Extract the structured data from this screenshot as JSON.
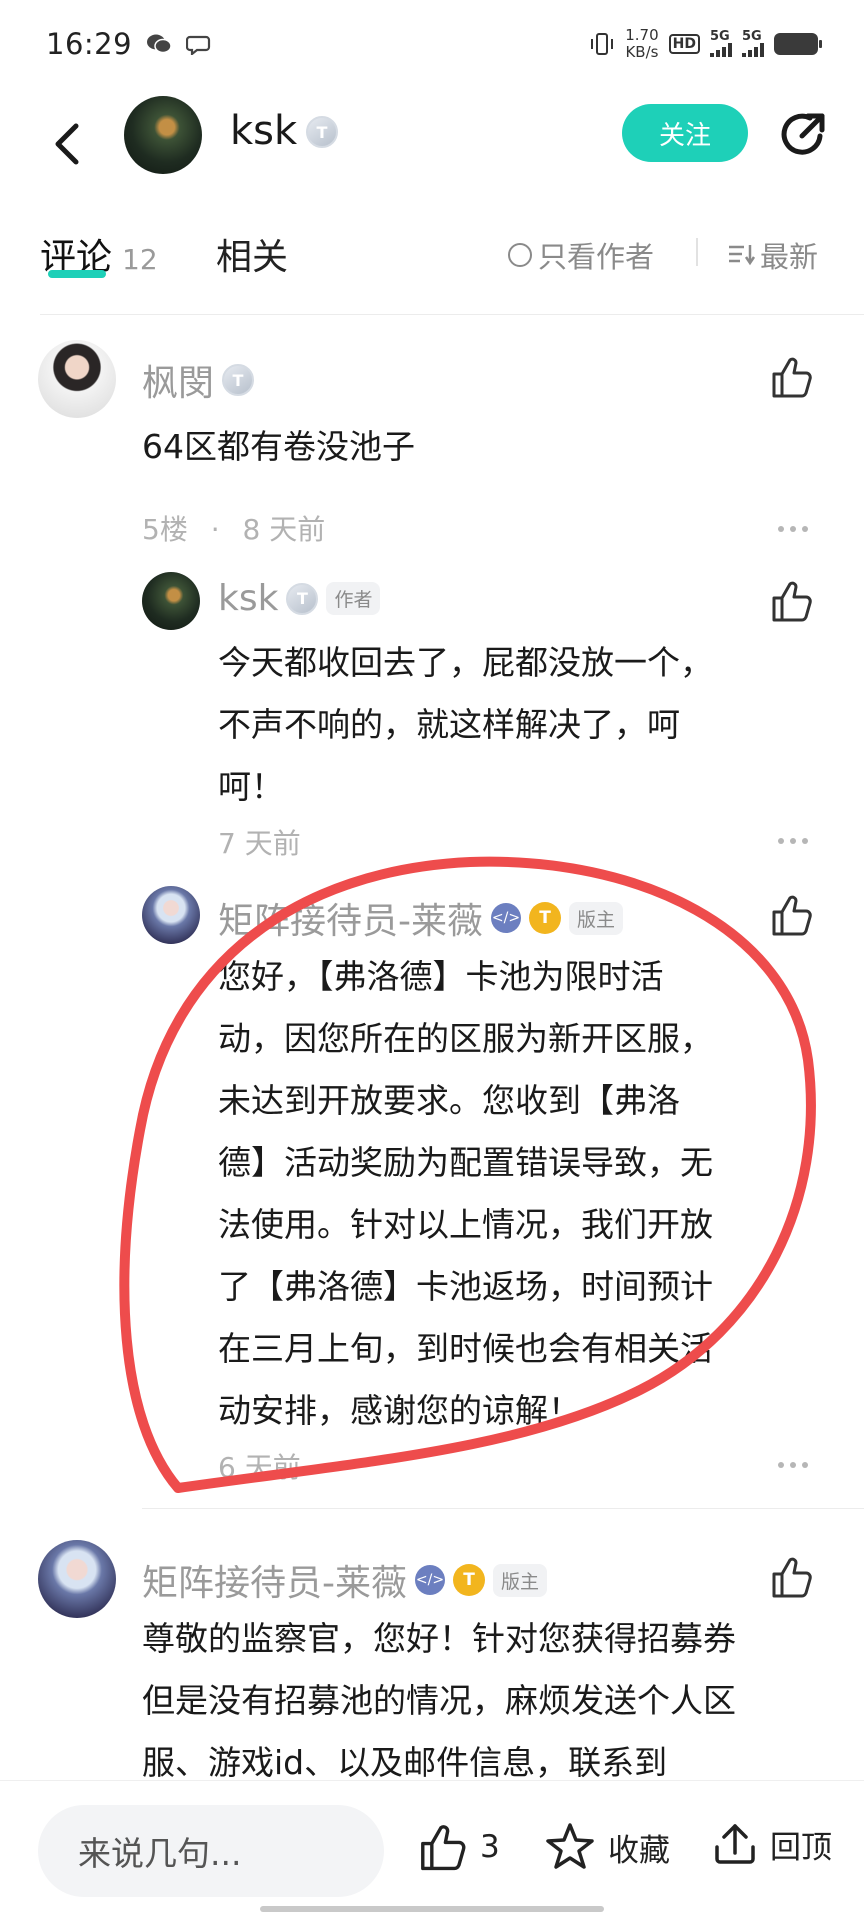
{
  "status_bar": {
    "time": "16:29",
    "net_speed_value": "1.70",
    "net_speed_unit": "KB/s",
    "hd_label": "HD",
    "sim1_label": "5G",
    "sim2_label": "5G",
    "icons": [
      "wechat-icon",
      "chat-bubble-icon",
      "vibrate-icon",
      "signal-icon",
      "battery-icon"
    ]
  },
  "header": {
    "username": "ksk",
    "tier": "T",
    "follow_label": "关注"
  },
  "tabs": {
    "comments_label": "评论",
    "comments_count": "12",
    "related_label": "相关",
    "author_only_label": "只看作者",
    "sort_label": "最新"
  },
  "comments": [
    {
      "username": "枫閔",
      "tier": "T",
      "text": "64区都有卷没池子",
      "floor": "5楼",
      "separator": "·",
      "time": "8 天前",
      "replies": [
        {
          "username": "ksk",
          "tier": "T",
          "badge": "作者",
          "lines": [
            "今天都收回去了，屁都没放一个，",
            "不声不响的，就这样解决了，呵",
            "呵！"
          ],
          "time": "7 天前"
        },
        {
          "username": "矩阵接待员-莱薇",
          "dev_badge": "</>",
          "tier": "T",
          "badge": "版主",
          "lines": [
            "您好，【弗洛德】卡池为限时活",
            "动，因您所在的区服为新开区服，",
            "未达到开放要求。您收到【弗洛",
            "德】活动奖励为配置错误导致，无",
            "法使用。针对以上情况，我们开放",
            "了【弗洛德】卡池返场，时间预计",
            "在三月上旬，到时候也会有相关活",
            "动安排，感谢您的谅解！"
          ],
          "time": "6 天前"
        }
      ]
    },
    {
      "username": "矩阵接待员-莱薇",
      "dev_badge": "</>",
      "tier": "T",
      "badge": "版主",
      "lines": [
        "尊敬的监察官，您好！针对您获得招募券",
        "但是没有招募池的情况，麻烦发送个人区",
        "服、游戏id、以及邮件信息，联系到"
      ]
    }
  ],
  "bottom_bar": {
    "input_placeholder": "来说几句...",
    "like_count": "3",
    "favorite_label": "收藏",
    "top_label": "回顶"
  },
  "colors": {
    "accent": "#1ed0b8",
    "annotation": "#ee4c4c",
    "meta_gray": "#b2b2b2"
  }
}
